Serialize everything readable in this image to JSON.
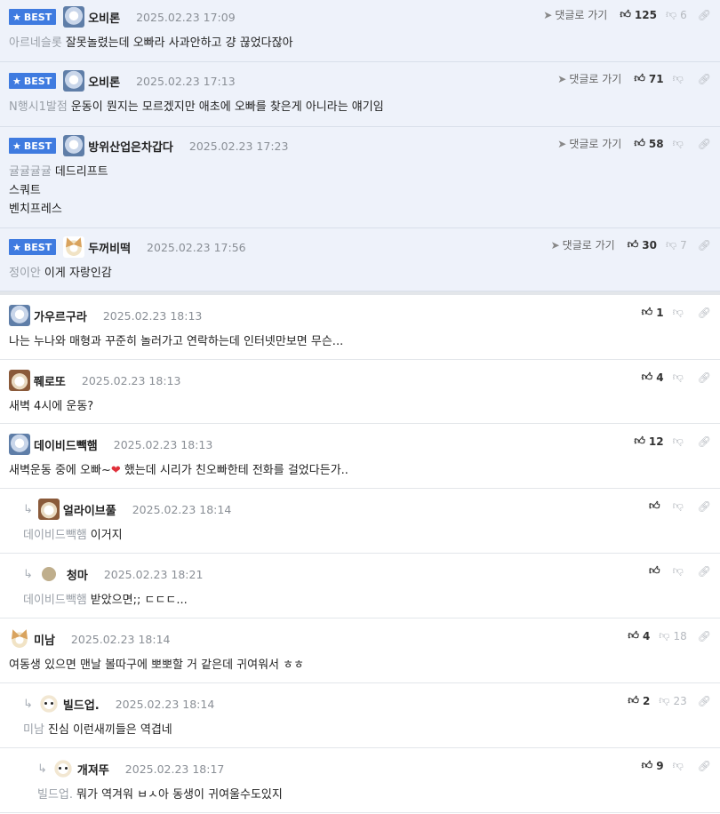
{
  "labels": {
    "best": "BEST",
    "reply_to": "댓글로 가기"
  },
  "best_comments": [
    {
      "nick": "오비론",
      "date": "2025.02.23 17:09",
      "likes": "125",
      "dislikes": "6",
      "mention": "아르네슬롯",
      "lines": [
        "잘못놀렸는데 오빠라 사과안하고 걍 끊었다잖아"
      ]
    },
    {
      "nick": "오비론",
      "date": "2025.02.23 17:13",
      "likes": "71",
      "dislikes": "",
      "mention": "N행시1발점",
      "lines": [
        "운동이 뭔지는 모르겠지만 애초에 오빠를 찾은게 아니라는 얘기임"
      ]
    },
    {
      "nick": "방위산업은차갑다",
      "date": "2025.02.23 17:23",
      "likes": "58",
      "dislikes": "",
      "mention": "귤귤귤귤",
      "lines": [
        "데드리프트",
        "스쿼트",
        "벤치프레스"
      ]
    },
    {
      "nick": "두꺼비떡",
      "date": "2025.02.23 17:56",
      "likes": "30",
      "dislikes": "7",
      "mention": "정이안",
      "lines": [
        "이게 자랑인감"
      ]
    }
  ],
  "comments": [
    {
      "nick": "가우르구라",
      "date": "2025.02.23 18:13",
      "likes": "1",
      "dislikes": "",
      "mention": "",
      "text": "나는 누나와 매형과 꾸준히 놀러가고 연락하는데 인터넷만보면 무슨..."
    },
    {
      "nick": "쮀로또",
      "date": "2025.02.23 18:13",
      "likes": "4",
      "dislikes": "",
      "mention": "",
      "text": "새벽 4시에 운동?"
    },
    {
      "nick": "데이비드빽햄",
      "date": "2025.02.23 18:13",
      "likes": "12",
      "dislikes": "",
      "mention": "",
      "text_before": "새벽운동 중에 오빠~",
      "heart": "❤",
      "text_after": " 했는데 시리가 친오빠한테 전화를 걸었다든가.."
    },
    {
      "nick": "얼라이브풀",
      "date": "2025.02.23 18:14",
      "likes": "",
      "dislikes": "",
      "mention": "데이비드빽햄",
      "text": "이거지"
    },
    {
      "nick": "청마",
      "date": "2025.02.23 18:21",
      "likes": "",
      "dislikes": "",
      "mention": "데이비드빽햄",
      "text": "받았으면;; ㄷㄷㄷ..."
    },
    {
      "nick": "미남",
      "date": "2025.02.23 18:14",
      "likes": "4",
      "dislikes": "18",
      "mention": "",
      "text": "여동생 있으면 맨날 볼따구에 뽀뽀할 거 같은데 귀여워서 ㅎㅎ"
    },
    {
      "nick": "빌드업.",
      "date": "2025.02.23 18:14",
      "likes": "2",
      "dislikes": "23",
      "mention": "미남",
      "text": "진심 이런새끼들은 역겹네"
    },
    {
      "nick": "개져뚜",
      "date": "2025.02.23 18:17",
      "likes": "9",
      "dislikes": "",
      "mention": "빌드업.",
      "text": "뭐가 역겨워 ㅂㅅ아 동생이 귀여울수도있지"
    }
  ]
}
